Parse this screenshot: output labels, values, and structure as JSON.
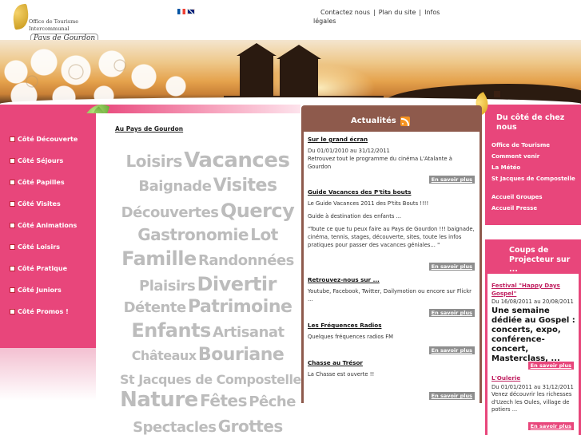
{
  "logo": {
    "line1": "Office de Tourisme",
    "line2": "Intercommunal",
    "line3": "Pays de Gourdon"
  },
  "top_links": [
    "Contactez nous",
    "Plan du site",
    "Infos légales"
  ],
  "separator": "|",
  "left_nav": [
    "Côté Découverte",
    "Côté Séjours",
    "Côté Papilles",
    "Côté Visites",
    "Côté Animations",
    "Côté Loisirs",
    "Côté Pratique",
    "Côté Juniors",
    "Côté Promos !"
  ],
  "center": {
    "heading": "Au Pays de Gourdon",
    "tag_cloud": [
      [
        "Loisirs",
        "Vacances"
      ],
      [
        "Baignade",
        "Visites"
      ],
      [
        "Découvertes",
        "Quercy"
      ],
      [
        "Gastronomie",
        "Lot"
      ],
      [
        "Famille",
        "Randonnées"
      ],
      [
        "Plaisirs",
        "Divertir"
      ],
      [
        "Détente",
        "Patrimoine"
      ],
      [
        "Enfants",
        "Artisanat"
      ],
      [
        "Châteaux",
        "Bouriane"
      ],
      [
        "St Jacques de Compostelle"
      ],
      [
        "Nature",
        "Fêtes",
        "Pêche"
      ],
      [
        "Spectacles",
        "Grottes"
      ]
    ]
  },
  "news": {
    "title": "Actualités",
    "more_label": "En savoir plus",
    "items": [
      {
        "title": "Sur le grand écran",
        "lines": [
          "Du 01/01/2010 au 31/12/2011",
          "Retrouvez tout le programme du cinéma L'Atalante à Gourdon"
        ]
      },
      {
        "title": "Guide Vacances des P'tits bouts",
        "lines": [
          "Le Guide Vacances 2011 des P'tits Bouts !!!!",
          "Guide à destination des enfants ...",
          "\"Toute ce que tu peux faire au Pays de Gourdon !!! baignade, cinéma, tennis, stages, découverte, sites, toute les infos pratiques pour passer des vacances géniales... \""
        ]
      },
      {
        "title": "Retrouvez-nous sur ...",
        "lines": [
          "Youtube, Facebook, Twitter, Dailymotion ou encore sur Flickr ..."
        ]
      },
      {
        "title": "Les Fréquences Radios",
        "lines": [
          "Quelques fréquences radios FM"
        ]
      },
      {
        "title": "Chasse au Trésor",
        "lines": [
          "La Chasse est ouverte !!"
        ]
      }
    ]
  },
  "right_top": {
    "title": "Du côté de chez nous",
    "links": [
      "Office de Tourisme",
      "Comment venir",
      "La Météo",
      "St Jacques de Compostelle",
      "Accueil Groupes",
      "Accueil Presse"
    ]
  },
  "right_bottom": {
    "title": "Coups de Projecteur sur ...",
    "more_label": "En savoir plus",
    "items": [
      {
        "title": "Festival \"Happy Days Gospel\"",
        "date": "Du 16/08/2011 au 20/08/2011",
        "headline": "Une semaine dédiée au Gospel : concerts, expo, conférence-concert, Masterclass, ..."
      },
      {
        "title": "L'Oulerie",
        "date": "Du 01/01/2011 au 31/12/2011",
        "text": "Venez découvrir les richesses d'Uzech les Oules, village de potiers ..."
      }
    ]
  },
  "colors": {
    "pink": "#e8467b",
    "brown": "#8e5a4c",
    "cloud_text": "#bcbcbc"
  }
}
